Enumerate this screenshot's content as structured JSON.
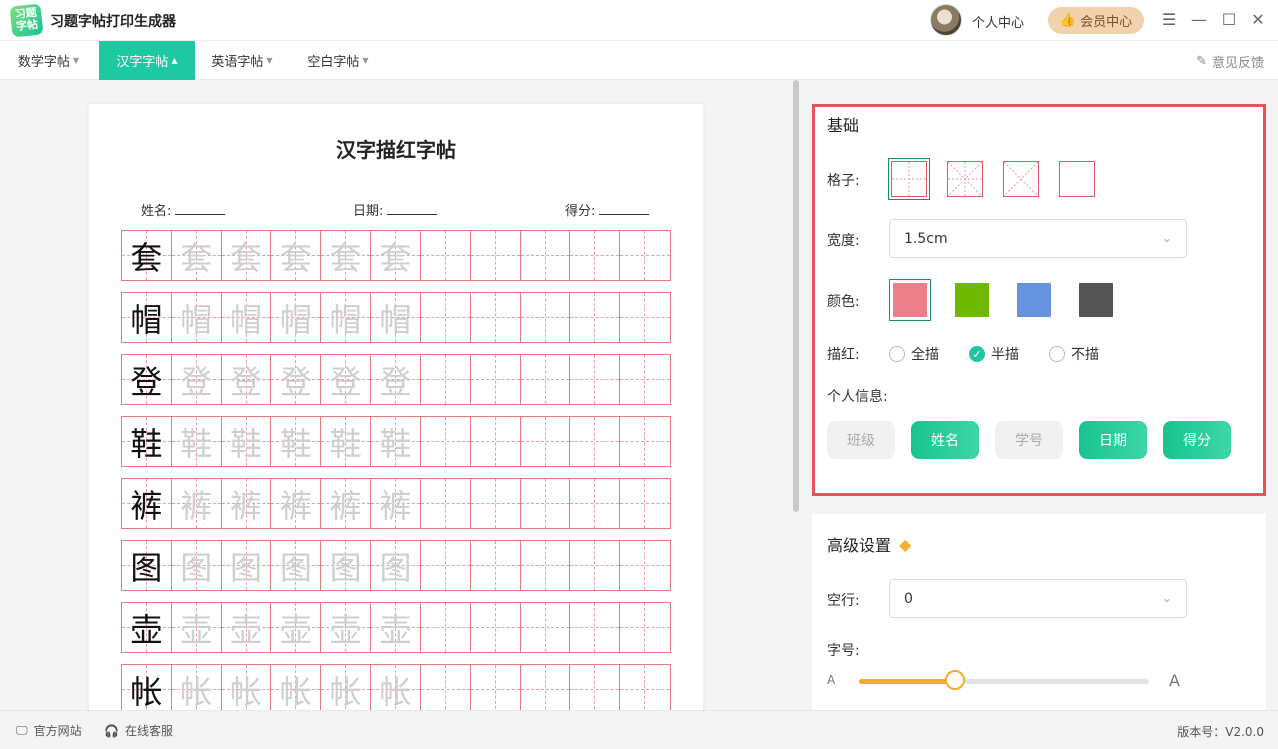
{
  "app": {
    "logo_text": "习题字帖",
    "title": "习题字帖打印生成器"
  },
  "header": {
    "user_center": "个人中心",
    "vip_label": "会员中心"
  },
  "nav": {
    "tabs": [
      {
        "label": "数学字帖"
      },
      {
        "label": "汉字字帖",
        "active": true
      },
      {
        "label": "英语字帖"
      },
      {
        "label": "空白字帖"
      }
    ],
    "feedback": "意见反馈"
  },
  "paper": {
    "title": "汉字描红字帖",
    "name_label": "姓名:",
    "date_label": "日期:",
    "score_label": "得分:",
    "characters": [
      "套",
      "帽",
      "登",
      "鞋",
      "裤",
      "图",
      "壶",
      "帐"
    ],
    "trace_count": 5,
    "columns": 11
  },
  "basic": {
    "title": "基础",
    "grid_label": "格子:",
    "width_label": "宽度:",
    "width_value": "1.5cm",
    "color_label": "颜色:",
    "colors": [
      "#ec808a",
      "#6fb700",
      "#6694e0",
      "#555555"
    ],
    "trace_label": "描红:",
    "trace_options": [
      {
        "label": "全描",
        "checked": false
      },
      {
        "label": "半描",
        "checked": true
      },
      {
        "label": "不描",
        "checked": false
      }
    ],
    "info_label": "个人信息:",
    "info_buttons": [
      {
        "label": "班级",
        "on": false
      },
      {
        "label": "姓名",
        "on": true
      },
      {
        "label": "学号",
        "on": false
      },
      {
        "label": "日期",
        "on": true
      },
      {
        "label": "得分",
        "on": true
      }
    ]
  },
  "advanced": {
    "title": "高级设置",
    "blank_label": "空行:",
    "blank_value": "0",
    "font_size_label": "字号:",
    "font_min": "A",
    "font_max": "A",
    "font_size_level": 0.33
  },
  "footer": {
    "website": "官方网站",
    "service": "在线客服",
    "version": "版本号：V2.0.0"
  }
}
